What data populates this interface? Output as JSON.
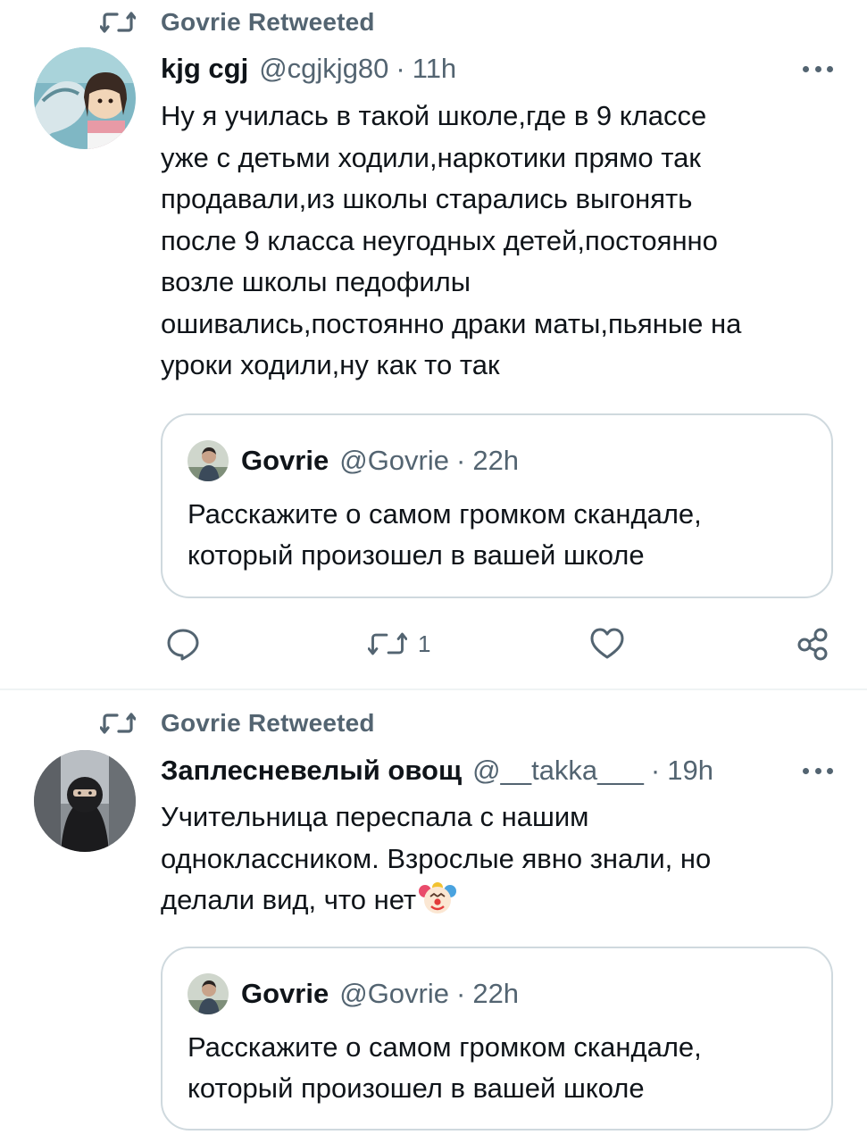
{
  "tweets": [
    {
      "retweet_label": "Govrie Retweeted",
      "author_name": "kjg cgj",
      "author_handle": "@cgjkjg80",
      "separator": "·",
      "time": "11h",
      "text_lines": [
        "Ну я училась в такой школе,где в 9 классе",
        "уже с детьми ходили,наркотики прямо так",
        "продавали,из школы старались выгонять",
        "после 9 класса неугодных детей,постоянно",
        "возле школы педофилы",
        "ошивались,постоянно драки маты,пьяные на",
        "уроки ходили,ну как то так"
      ],
      "quote": {
        "author_name": "Govrie",
        "author_handle": "@Govrie",
        "separator": "·",
        "time": "22h",
        "text_lines": [
          "Расскажите о самом громком скандале,",
          "который произошел в вашей школе"
        ]
      },
      "actions": {
        "reply_count": "",
        "retweet_count": "1",
        "like_count": ""
      }
    },
    {
      "retweet_label": "Govrie Retweeted",
      "author_name": "Заплесневелый овощ",
      "author_handle": "@__takka___",
      "separator": "·",
      "time": "19h",
      "text_lines": [
        "Учительница переспала с нашим",
        "одноклассником. Взрослые явно знали, но",
        "делали вид, что нет"
      ],
      "emoji_icon": "clown-face-icon",
      "quote": {
        "author_name": "Govrie",
        "author_handle": "@Govrie",
        "separator": "·",
        "time": "22h",
        "text_lines": [
          "Расскажите о самом громком скандале,",
          "который произошел в вашей школе"
        ]
      }
    }
  ],
  "colors": {
    "text_primary": "#0f1419",
    "text_secondary": "#536471",
    "border": "#cfd9de",
    "divider": "#eff3f4"
  }
}
